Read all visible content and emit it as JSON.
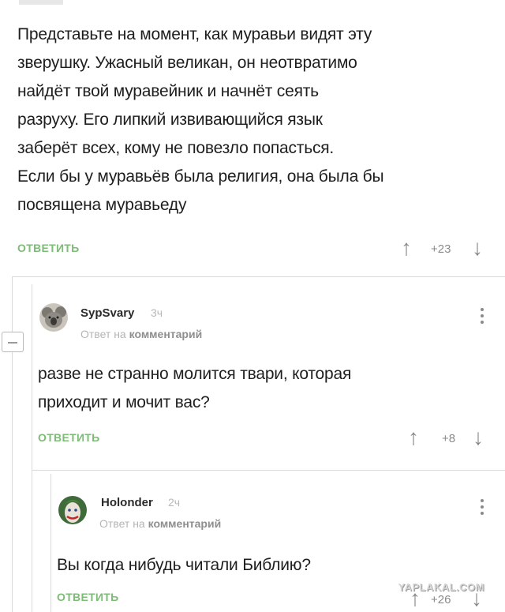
{
  "comments": [
    {
      "text_lines": [
        "Представьте на момент, как муравьи видят эту",
        "зверушку. Ужасный великан, он неотвратимо",
        "найдёт твой муравейник и начнёт сеять",
        "разруху. Его липкий извивающийся язык",
        "заберёт всех, кому не повезло попасться.",
        "Если бы у муравьёв была религия, она была бы",
        "посвящена муравьеду"
      ],
      "reply_label": "ОТВЕТИТЬ",
      "score": "+23"
    },
    {
      "username": "SypSvary",
      "time": "3ч",
      "reply_to_prefix": "Ответ на",
      "reply_to_target": "комментарий",
      "text_lines": [
        "разве не странно молится твари, которая",
        "приходит и мочит вас?"
      ],
      "reply_label": "ОТВЕТИТЬ",
      "score": "+8"
    },
    {
      "username": "Holonder",
      "time": "2ч",
      "reply_to_prefix": "Ответ на",
      "reply_to_target": "комментарий",
      "text_lines": [
        "Вы когда нибудь читали Библию?"
      ],
      "reply_label": "ОТВЕТИТЬ",
      "score": "+26"
    }
  ],
  "watermark": "YAPLAKAL.COM",
  "icons": {
    "upvote": "up-arrow-icon",
    "downvote": "down-arrow-icon",
    "menu": "vertical-dots-icon",
    "collapse": "minus-icon"
  },
  "colors": {
    "reply_link": "#7cbc76",
    "text": "#1e1e1e",
    "muted": "#8a8a8a"
  }
}
